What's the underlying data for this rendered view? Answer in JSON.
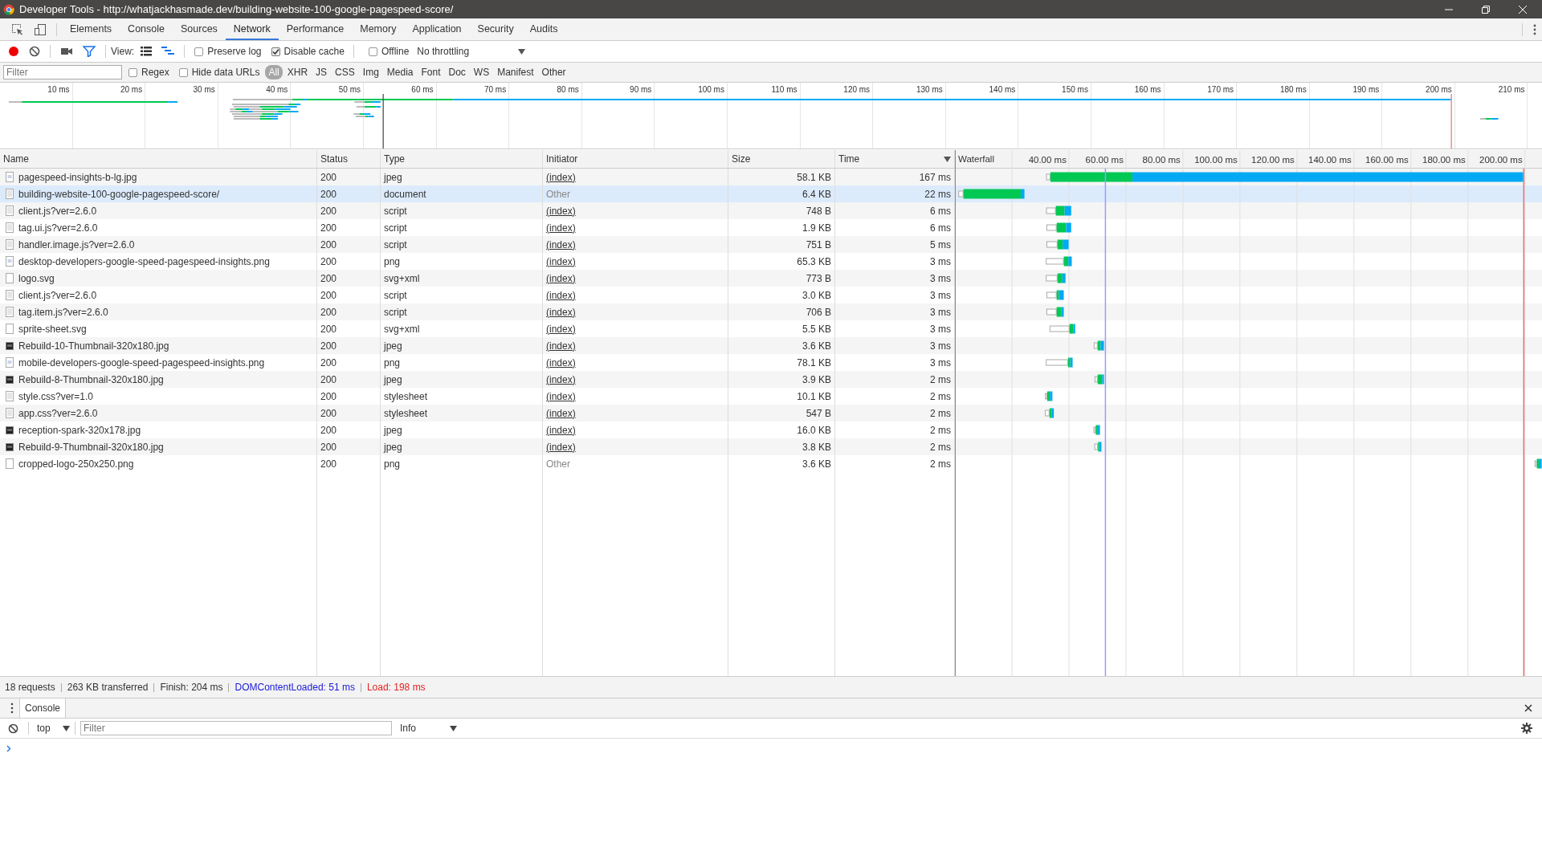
{
  "window": {
    "title": "Developer Tools - http://whatjackhasmade.dev/building-website-100-google-pagespeed-score/"
  },
  "panel_tabs": [
    {
      "label": "Elements",
      "selected": false
    },
    {
      "label": "Console",
      "selected": false
    },
    {
      "label": "Sources",
      "selected": false
    },
    {
      "label": "Network",
      "selected": true
    },
    {
      "label": "Performance",
      "selected": false
    },
    {
      "label": "Memory",
      "selected": false
    },
    {
      "label": "Application",
      "selected": false
    },
    {
      "label": "Security",
      "selected": false
    },
    {
      "label": "Audits",
      "selected": false
    }
  ],
  "toolbar": {
    "recording": true,
    "filter_on": true,
    "screenshots_on": false,
    "view_label": "View:",
    "view_modes": [
      {
        "kind": "list",
        "selected": false
      },
      {
        "kind": "waterfall",
        "selected": true
      }
    ],
    "options": [
      {
        "label": "Preserve log",
        "checked": false
      },
      {
        "label": "Disable cache",
        "checked": true
      },
      {
        "label": "Offline",
        "checked": false
      }
    ],
    "throttling": "No throttling"
  },
  "filter_bar": {
    "placeholder": "Filter",
    "options": [
      {
        "label": "Regex",
        "checked": false
      },
      {
        "label": "Hide data URLs",
        "checked": false
      }
    ],
    "types": [
      {
        "label": "All",
        "selected": true
      },
      {
        "label": "XHR",
        "selected": false
      },
      {
        "label": "JS",
        "selected": false
      },
      {
        "label": "CSS",
        "selected": false
      },
      {
        "label": "Img",
        "selected": false
      },
      {
        "label": "Media",
        "selected": false
      },
      {
        "label": "Font",
        "selected": false
      },
      {
        "label": "Doc",
        "selected": false
      },
      {
        "label": "WS",
        "selected": false
      },
      {
        "label": "Manifest",
        "selected": false
      },
      {
        "label": "Other",
        "selected": false
      }
    ]
  },
  "overview": {
    "ticks": [
      "10 ms",
      "20 ms",
      "30 ms",
      "40 ms",
      "50 ms",
      "60 ms",
      "70 ms",
      "80 ms",
      "90 ms",
      "100 ms",
      "110 ms",
      "120 ms",
      "130 ms",
      "140 ms",
      "150 ms",
      "160 ms",
      "170 ms",
      "180 ms",
      "190 ms",
      "200 ms",
      "210 ms"
    ]
  },
  "table": {
    "columns": [
      {
        "label": "Name",
        "sorted": false
      },
      {
        "label": "Status",
        "sorted": false
      },
      {
        "label": "Type",
        "sorted": false
      },
      {
        "label": "Initiator",
        "sorted": false
      },
      {
        "label": "Size",
        "sorted": false
      },
      {
        "label": "Time",
        "sorted": true
      }
    ],
    "rows": [
      {
        "kind": "image",
        "name": "pagespeed-insights-b-lg.jpg",
        "status": "200",
        "type": "jpeg",
        "initiator": "(index)",
        "initiator_link": true,
        "size": "58.1 KB",
        "time": "167 ms",
        "selected": false
      },
      {
        "kind": "file",
        "name": "building-website-100-google-pagespeed-score/",
        "status": "200",
        "type": "document",
        "initiator": "Other",
        "initiator_link": false,
        "size": "6.4 KB",
        "time": "22 ms",
        "selected": true
      },
      {
        "kind": "file",
        "name": "client.js?ver=2.6.0",
        "status": "200",
        "type": "script",
        "initiator": "(index)",
        "initiator_link": true,
        "size": "748 B",
        "time": "6 ms",
        "selected": false
      },
      {
        "kind": "file",
        "name": "tag.ui.js?ver=2.6.0",
        "status": "200",
        "type": "script",
        "initiator": "(index)",
        "initiator_link": true,
        "size": "1.9 KB",
        "time": "6 ms",
        "selected": false
      },
      {
        "kind": "file",
        "name": "handler.image.js?ver=2.6.0",
        "status": "200",
        "type": "script",
        "initiator": "(index)",
        "initiator_link": true,
        "size": "751 B",
        "time": "5 ms",
        "selected": false
      },
      {
        "kind": "image",
        "name": "desktop-developers-google-speed-pagespeed-insights.png",
        "status": "200",
        "type": "png",
        "initiator": "(index)",
        "initiator_link": true,
        "size": "65.3 KB",
        "time": "3 ms",
        "selected": false
      },
      {
        "kind": "blank",
        "name": "logo.svg",
        "status": "200",
        "type": "svg+xml",
        "initiator": "(index)",
        "initiator_link": true,
        "size": "773 B",
        "time": "3 ms",
        "selected": false
      },
      {
        "kind": "file",
        "name": "client.js?ver=2.6.0",
        "status": "200",
        "type": "script",
        "initiator": "(index)",
        "initiator_link": true,
        "size": "3.0 KB",
        "time": "3 ms",
        "selected": false
      },
      {
        "kind": "file",
        "name": "tag.item.js?ver=2.6.0",
        "status": "200",
        "type": "script",
        "initiator": "(index)",
        "initiator_link": true,
        "size": "706 B",
        "time": "3 ms",
        "selected": false
      },
      {
        "kind": "blank",
        "name": "sprite-sheet.svg",
        "status": "200",
        "type": "svg+xml",
        "initiator": "(index)",
        "initiator_link": true,
        "size": "5.5 KB",
        "time": "3 ms",
        "selected": false
      },
      {
        "kind": "thumbnail",
        "name": "Rebuild-10-Thumbnail-320x180.jpg",
        "status": "200",
        "type": "jpeg",
        "initiator": "(index)",
        "initiator_link": true,
        "size": "3.6 KB",
        "time": "3 ms",
        "selected": false
      },
      {
        "kind": "image",
        "name": "mobile-developers-google-speed-pagespeed-insights.png",
        "status": "200",
        "type": "png",
        "initiator": "(index)",
        "initiator_link": true,
        "size": "78.1 KB",
        "time": "3 ms",
        "selected": false
      },
      {
        "kind": "thumbnail",
        "name": "Rebuild-8-Thumbnail-320x180.jpg",
        "status": "200",
        "type": "jpeg",
        "initiator": "(index)",
        "initiator_link": true,
        "size": "3.9 KB",
        "time": "2 ms",
        "selected": false
      },
      {
        "kind": "file",
        "name": "style.css?ver=1.0",
        "status": "200",
        "type": "stylesheet",
        "initiator": "(index)",
        "initiator_link": true,
        "size": "10.1 KB",
        "time": "2 ms",
        "selected": false
      },
      {
        "kind": "file",
        "name": "app.css?ver=2.6.0",
        "status": "200",
        "type": "stylesheet",
        "initiator": "(index)",
        "initiator_link": true,
        "size": "547 B",
        "time": "2 ms",
        "selected": false
      },
      {
        "kind": "thumbnail",
        "name": "reception-spark-320x178.jpg",
        "status": "200",
        "type": "jpeg",
        "initiator": "(index)",
        "initiator_link": true,
        "size": "16.0 KB",
        "time": "2 ms",
        "selected": false
      },
      {
        "kind": "thumbnail",
        "name": "Rebuild-9-Thumbnail-320x180.jpg",
        "status": "200",
        "type": "jpeg",
        "initiator": "(index)",
        "initiator_link": true,
        "size": "3.8 KB",
        "time": "2 ms",
        "selected": false
      },
      {
        "kind": "blank",
        "name": "cropped-logo-250x250.png",
        "status": "200",
        "type": "png",
        "initiator": "Other",
        "initiator_link": false,
        "size": "3.6 KB",
        "time": "2 ms",
        "selected": false
      }
    ],
    "waterfall": {
      "label": "Waterfall",
      "ticks": [
        "40.00 ms",
        "60.00 ms",
        "80.00 ms",
        "100.00 ms",
        "120.00 ms",
        "140.00 ms",
        "160.00 ms",
        "180.00 ms",
        "200.00 ms"
      ]
    }
  },
  "status_bar": [
    {
      "text": "18 requests",
      "color": "#333333"
    },
    {
      "text": "263 KB transferred",
      "color": "#333333"
    },
    {
      "text": "Finish: 204 ms",
      "color": "#333333"
    },
    {
      "text": "DOMContentLoaded: 51 ms",
      "color": "#1a1ad6"
    },
    {
      "text": "Load: 198 ms",
      "color": "#e52222"
    }
  ],
  "drawer": {
    "tabs": [
      {
        "label": "Console",
        "selected": true
      }
    ],
    "context": "top",
    "filter_placeholder": "Filter",
    "level": "Info"
  }
}
